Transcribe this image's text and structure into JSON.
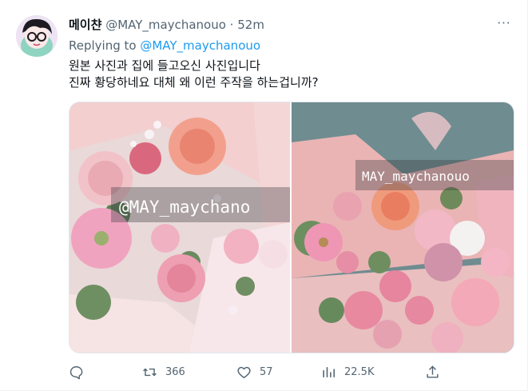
{
  "tweet": {
    "display_name": "메이챤",
    "handle": "@MAY_maychanouo",
    "separator": "·",
    "time": "52m",
    "reply_prefix": "Replying to",
    "reply_handle": "@MAY_maychanouo",
    "text_lines": [
      "원본 사진과 집에 들고오신 사진입니다",
      "진짜 황당하네요 대체 왜 이런 주작을 하는겁니까?"
    ],
    "more_label": "···"
  },
  "media": {
    "left_watermark": "@MAY_maychano",
    "right_watermark": "MAY_maychanouo"
  },
  "actions": {
    "reply_count": "",
    "retweet_count": "366",
    "like_count": "57",
    "view_count": "22.5K"
  },
  "icons": [
    "avatar-icon",
    "more-icon",
    "reply-icon",
    "retweet-icon",
    "like-icon",
    "views-icon",
    "share-icon"
  ],
  "colors": {
    "link": "#1d9bf0",
    "secondary": "#536471",
    "text": "#0f1419"
  }
}
